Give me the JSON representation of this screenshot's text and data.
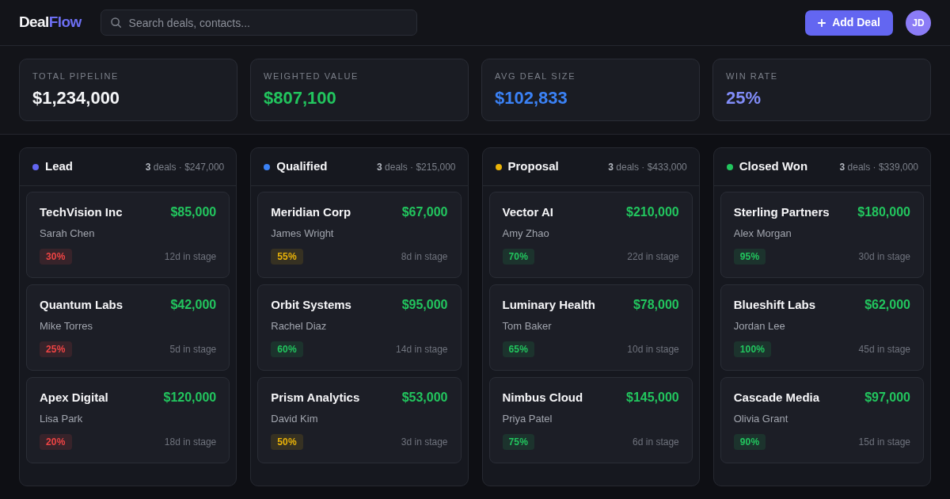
{
  "header": {
    "logo": {
      "text": "Deal",
      "accent": "Flow"
    },
    "search": {
      "placeholder": "Search deals, contacts..."
    },
    "add_button": {
      "label": "Add Deal"
    },
    "avatar": {
      "initials": "JD"
    }
  },
  "stats": [
    {
      "label": "TOTAL PIPELINE",
      "value": "$1,234,000",
      "color": "#f3f4f6"
    },
    {
      "label": "WEIGHTED VALUE",
      "value": "$807,100",
      "color": "#22c55e"
    },
    {
      "label": "AVG DEAL SIZE",
      "value": "$102,833",
      "color": "#3b82f6"
    },
    {
      "label": "WIN RATE",
      "value": "25%",
      "color": "#818cf8"
    }
  ],
  "columns": [
    {
      "title": "Lead",
      "color": "#6366f1",
      "summary": "**3** deals · $247,000",
      "deals": [
        {
          "company": "TechVision Inc",
          "amount": "$85,000",
          "contact": "Sarah Chen",
          "probability": "30%",
          "color": "#ef4444",
          "days": "12d in stage"
        },
        {
          "company": "Quantum Labs",
          "amount": "$42,000",
          "contact": "Mike Torres",
          "probability": "25%",
          "color": "#ef4444",
          "days": "5d in stage"
        },
        {
          "company": "Apex Digital",
          "amount": "$120,000",
          "contact": "Lisa Park",
          "probability": "20%",
          "color": "#ef4444",
          "days": "18d in stage"
        }
      ]
    },
    {
      "title": "Qualified",
      "color": "#3b82f6",
      "summary": "**3** deals · $215,000",
      "deals": [
        {
          "company": "Meridian Corp",
          "amount": "$67,000",
          "contact": "James Wright",
          "probability": "55%",
          "color": "#eab308",
          "days": "8d in stage"
        },
        {
          "company": "Orbit Systems",
          "amount": "$95,000",
          "contact": "Rachel Diaz",
          "probability": "60%",
          "color": "#22c55e",
          "days": "14d in stage"
        },
        {
          "company": "Prism Analytics",
          "amount": "$53,000",
          "contact": "David Kim",
          "probability": "50%",
          "color": "#eab308",
          "days": "3d in stage"
        }
      ]
    },
    {
      "title": "Proposal",
      "color": "#eab308",
      "summary": "**3** deals · $433,000",
      "deals": [
        {
          "company": "Vector AI",
          "amount": "$210,000",
          "contact": "Amy Zhao",
          "probability": "70%",
          "color": "#22c55e",
          "days": "22d in stage"
        },
        {
          "company": "Luminary Health",
          "amount": "$78,000",
          "contact": "Tom Baker",
          "probability": "65%",
          "color": "#22c55e",
          "days": "10d in stage"
        },
        {
          "company": "Nimbus Cloud",
          "amount": "$145,000",
          "contact": "Priya Patel",
          "probability": "75%",
          "color": "#22c55e",
          "days": "6d in stage"
        }
      ]
    },
    {
      "title": "Closed Won",
      "color": "#22c55e",
      "summary": "**3** deals · $339,000",
      "deals": [
        {
          "company": "Sterling Partners",
          "amount": "$180,000",
          "contact": "Alex Morgan",
          "probability": "95%",
          "color": "#22c55e",
          "days": "30d in stage"
        },
        {
          "company": "Blueshift Labs",
          "amount": "$62,000",
          "contact": "Jordan Lee",
          "probability": "100%",
          "color": "#22c55e",
          "days": "45d in stage"
        },
        {
          "company": "Cascade Media",
          "amount": "$97,000",
          "contact": "Olivia Grant",
          "probability": "90%",
          "color": "#22c55e",
          "days": "15d in stage"
        }
      ]
    }
  ]
}
